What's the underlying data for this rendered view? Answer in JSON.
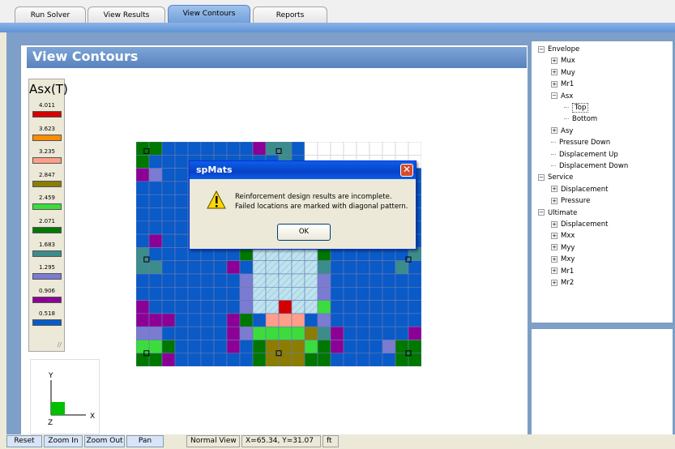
{
  "tabs": [
    "Run Solver",
    "View Results",
    "View Contours",
    "Reports"
  ],
  "active_tab": "View Contours",
  "panel_title": "View Contours",
  "legend": {
    "title": "Asx(T)",
    "items": [
      {
        "value": "4.011",
        "color": "#d40000"
      },
      {
        "value": "3.623",
        "color": "#ff8c00"
      },
      {
        "value": "3.235",
        "color": "#ff9e8a"
      },
      {
        "value": "2.847",
        "color": "#8c7d00"
      },
      {
        "value": "2.459",
        "color": "#3cdc3c"
      },
      {
        "value": "2.071",
        "color": "#007800"
      },
      {
        "value": "1.683",
        "color": "#3c8c8c"
      },
      {
        "value": "1.295",
        "color": "#7b7bd2"
      },
      {
        "value": "0.906",
        "color": "#8c0096"
      },
      {
        "value": "0.518",
        "color": "#0a5ac8"
      }
    ]
  },
  "axis": {
    "y": "Y",
    "x": "X",
    "z": "Z"
  },
  "dialog": {
    "title": "spMats",
    "message_line1": "Reinforcement design results are incomplete.",
    "message_line2": "Failed locations are marked with diagonal pattern.",
    "ok": "OK"
  },
  "tree": [
    {
      "label": "Envelope",
      "toggle": "−",
      "level": 0
    },
    {
      "label": "Mux",
      "toggle": "+",
      "level": 1
    },
    {
      "label": "Muy",
      "toggle": "+",
      "level": 1
    },
    {
      "label": "Mr1",
      "toggle": "+",
      "level": 1
    },
    {
      "label": "Asx",
      "toggle": "−",
      "level": 1
    },
    {
      "label": "Top",
      "toggle": "",
      "level": 2,
      "selected": true
    },
    {
      "label": "Bottom",
      "toggle": "",
      "level": 2
    },
    {
      "label": "Asy",
      "toggle": "+",
      "level": 1
    },
    {
      "label": "Pressure Down",
      "toggle": "",
      "level": 1
    },
    {
      "label": "Displacement Up",
      "toggle": "",
      "level": 1
    },
    {
      "label": "Displacement Down",
      "toggle": "",
      "level": 1
    },
    {
      "label": "Service",
      "toggle": "−",
      "level": 0
    },
    {
      "label": "Displacement",
      "toggle": "+",
      "level": 1
    },
    {
      "label": "Pressure",
      "toggle": "+",
      "level": 1
    },
    {
      "label": "Ultimate",
      "toggle": "−",
      "level": 0
    },
    {
      "label": "Displacement",
      "toggle": "+",
      "level": 1
    },
    {
      "label": "Mxx",
      "toggle": "+",
      "level": 1
    },
    {
      "label": "Myy",
      "toggle": "+",
      "level": 1
    },
    {
      "label": "Mxy",
      "toggle": "+",
      "level": 1
    },
    {
      "label": "Mr1",
      "toggle": "+",
      "level": 1
    },
    {
      "label": "Mr2",
      "toggle": "+",
      "level": 1
    }
  ],
  "statusbar": {
    "reset": "Reset",
    "zoom_in": "Zoom In",
    "zoom_out": "Zoom Out",
    "pan": "Pan",
    "view": "Normal View",
    "coords": "X=65.34, Y=31.07",
    "units": "ft"
  }
}
